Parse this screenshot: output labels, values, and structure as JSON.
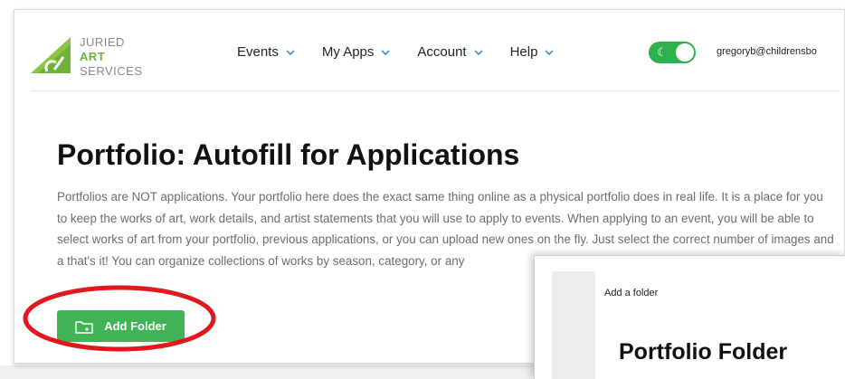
{
  "brand": {
    "logo_line1": "JURIED",
    "logo_line2": "ART",
    "logo_line3": "SERVICES",
    "accent_color": "#6fb23a"
  },
  "nav": {
    "items": [
      {
        "label": "Events",
        "icon": "chevron-down-icon"
      },
      {
        "label": "My Apps",
        "icon": "chevron-down-icon"
      },
      {
        "label": "Account",
        "icon": "chevron-down-icon"
      },
      {
        "label": "Help",
        "icon": "chevron-down-icon"
      }
    ]
  },
  "header": {
    "theme_toggle_icon": "moon-icon",
    "theme_toggle_state": "on",
    "user_email": "gregoryb@childrensbo"
  },
  "main": {
    "title": "Portfolio: Autofill for Applications",
    "description": "Portfolios are NOT applications. Your portfolio here does the exact same thing online as a physical portfolio does in real life. It is a place for you to keep the works of art, work details, and artist statements that you will use to apply to events. When applying to an event, you will be able to select works of art from your portfolio, previous applications, or you can upload new ones on the fly. Just select the correct number of images and a that's it! You can organize collections of works by season, category, or any",
    "add_folder_label": "Add Folder",
    "add_folder_icon": "folder-add-icon",
    "button_color": "#41b555"
  },
  "overlay": {
    "label": "Add a folder",
    "title": "Portfolio Folder"
  },
  "annotation": {
    "ellipse_color": "#e0191f"
  }
}
